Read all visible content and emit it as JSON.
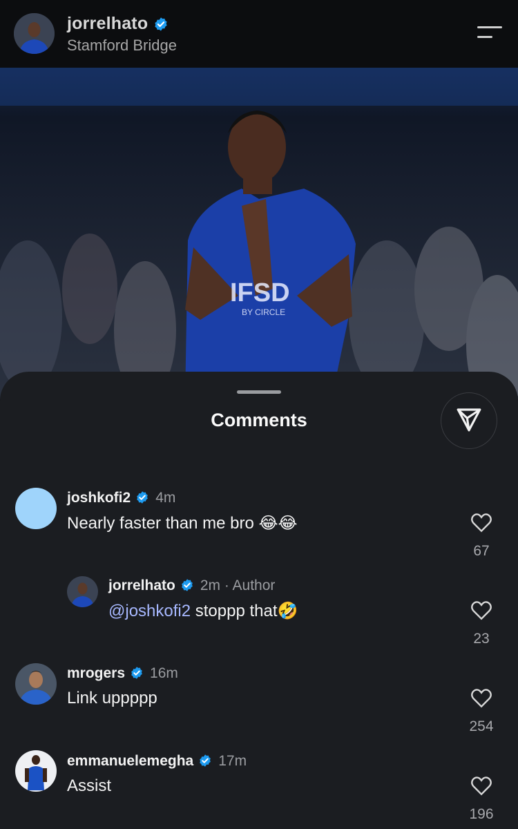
{
  "header": {
    "username": "jorrelhato",
    "location": "Stamford Bridge",
    "verified": true
  },
  "photo": {
    "shirt_sponsor": "IFSD",
    "shirt_sub": "BY CIRCLE"
  },
  "comments_sheet": {
    "title": "Comments",
    "comments": [
      {
        "username": "joshkofi2",
        "verified": true,
        "time": "4m",
        "text": "Nearly faster than me bro 😂😂",
        "likes": "67",
        "avatar_color": "#9fd4fb"
      },
      {
        "username": "jorrelhato",
        "verified": true,
        "time": "2m · Author",
        "mention": "@joshkofi2",
        "text": " stoppp that🤣",
        "likes": "23",
        "reply": true
      },
      {
        "username": "mrogers",
        "verified": true,
        "time": "16m",
        "text": "Link uppppp",
        "likes": "254"
      },
      {
        "username": "emmanuelemegha",
        "verified": true,
        "time": "17m",
        "text": "Assist",
        "likes": "196"
      }
    ]
  },
  "colors": {
    "sheet_bg": "#1b1d21",
    "verified_blue": "#1d9bf0",
    "mention": "#a7b8ff",
    "kit_blue": "#1b3fa8"
  },
  "icons": [
    "menu-icon",
    "verified-badge-icon",
    "send-icon",
    "heart-icon"
  ]
}
